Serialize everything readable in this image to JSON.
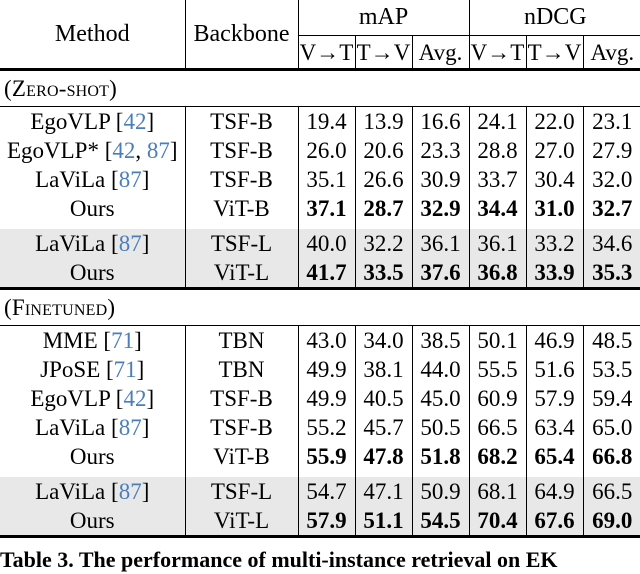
{
  "table": {
    "header": {
      "method": "Method",
      "backbone": "Backbone",
      "groups": [
        {
          "label": "mAP",
          "cols": [
            "V→T",
            "T→V",
            "Avg."
          ]
        },
        {
          "label": "nDCG",
          "cols": [
            "V→T",
            "T→V",
            "Avg."
          ]
        }
      ]
    },
    "sections": [
      {
        "label": "(Zero-shot)",
        "rows": [
          {
            "method": "EgoVLP",
            "cites": [
              "42"
            ],
            "star": false,
            "backbone": "TSF-B",
            "values": [
              "19.4",
              "13.9",
              "16.6",
              "24.1",
              "22.0",
              "23.1"
            ],
            "bold": false,
            "shaded": false
          },
          {
            "method": "EgoVLP",
            "cites": [
              "42",
              "87"
            ],
            "star": true,
            "backbone": "TSF-B",
            "values": [
              "26.0",
              "20.6",
              "23.3",
              "28.8",
              "27.0",
              "27.9"
            ],
            "bold": false,
            "shaded": false
          },
          {
            "method": "LaViLa",
            "cites": [
              "87"
            ],
            "star": false,
            "backbone": "TSF-B",
            "values": [
              "35.1",
              "26.6",
              "30.9",
              "33.7",
              "30.4",
              "32.0"
            ],
            "bold": false,
            "shaded": false
          },
          {
            "method": "Ours",
            "cites": [],
            "star": false,
            "backbone": "ViT-B",
            "values": [
              "37.1",
              "28.7",
              "32.9",
              "34.4",
              "31.0",
              "32.7"
            ],
            "bold": true,
            "shaded": false
          },
          {
            "method": "LaViLa",
            "cites": [
              "87"
            ],
            "star": false,
            "backbone": "TSF-L",
            "values": [
              "40.0",
              "32.2",
              "36.1",
              "36.1",
              "33.2",
              "34.6"
            ],
            "bold": false,
            "shaded": true
          },
          {
            "method": "Ours",
            "cites": [],
            "star": false,
            "backbone": "ViT-L",
            "values": [
              "41.7",
              "33.5",
              "37.6",
              "36.8",
              "33.9",
              "35.3"
            ],
            "bold": true,
            "shaded": true
          }
        ]
      },
      {
        "label": "(Finetuned)",
        "rows": [
          {
            "method": "MME",
            "cites": [
              "71"
            ],
            "star": false,
            "backbone": "TBN",
            "values": [
              "43.0",
              "34.0",
              "38.5",
              "50.1",
              "46.9",
              "48.5"
            ],
            "bold": false,
            "shaded": false
          },
          {
            "method": "JPoSE",
            "cites": [
              "71"
            ],
            "star": false,
            "backbone": "TBN",
            "values": [
              "49.9",
              "38.1",
              "44.0",
              "55.5",
              "51.6",
              "53.5"
            ],
            "bold": false,
            "shaded": false
          },
          {
            "method": "EgoVLP",
            "cites": [
              "42"
            ],
            "star": false,
            "backbone": "TSF-B",
            "values": [
              "49.9",
              "40.5",
              "45.0",
              "60.9",
              "57.9",
              "59.4"
            ],
            "bold": false,
            "shaded": false
          },
          {
            "method": "LaViLa",
            "cites": [
              "87"
            ],
            "star": false,
            "backbone": "TSF-B",
            "values": [
              "55.2",
              "45.7",
              "50.5",
              "66.5",
              "63.4",
              "65.0"
            ],
            "bold": false,
            "shaded": false
          },
          {
            "method": "Ours",
            "cites": [],
            "star": false,
            "backbone": "ViT-B",
            "values": [
              "55.9",
              "47.8",
              "51.8",
              "68.2",
              "65.4",
              "66.8"
            ],
            "bold": true,
            "shaded": false
          },
          {
            "method": "LaViLa",
            "cites": [
              "87"
            ],
            "star": false,
            "backbone": "TSF-L",
            "values": [
              "54.7",
              "47.1",
              "50.9",
              "68.1",
              "64.9",
              "66.5"
            ],
            "bold": false,
            "shaded": true
          },
          {
            "method": "Ours",
            "cites": [],
            "star": false,
            "backbone": "ViT-L",
            "values": [
              "57.9",
              "51.1",
              "54.5",
              "70.4",
              "67.6",
              "69.0"
            ],
            "bold": true,
            "shaded": true
          }
        ]
      }
    ]
  },
  "caption": {
    "text": "Table 3. The performance of multi-instance retrieval on EK"
  },
  "colors": {
    "citation": "#4a7ebb",
    "shaded_row": "#e8e8e8",
    "rule": "#000000"
  }
}
